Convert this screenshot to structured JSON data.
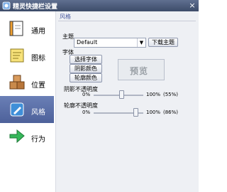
{
  "window": {
    "title": "精灵快捷栏设置",
    "close_glyph": "×"
  },
  "sidebar": {
    "items": [
      {
        "label": "通用",
        "icon": "notebook-icon"
      },
      {
        "label": "图标",
        "icon": "sticky-note-icon"
      },
      {
        "label": "位置",
        "icon": "boxes-icon"
      },
      {
        "label": "风格",
        "icon": "pen-icon",
        "active": true
      },
      {
        "label": "行为",
        "icon": "arrow-icon"
      }
    ]
  },
  "content": {
    "section_title": "风格",
    "theme_label": "主题",
    "theme_value": "Default",
    "download_theme_label": "下载主题",
    "font_label": "字体",
    "select_font_label": "选择字体",
    "shadow_color_label": "阴影颜色",
    "outline_color_label": "轮廓颜色",
    "preview_text": "预览",
    "shadow_opacity_label": "阴影不透明度",
    "shadow_min": "0%",
    "shadow_max": "100%",
    "shadow_value": "(55%)",
    "shadow_level": 0.55,
    "outline_opacity_label": "轮廓不透明度",
    "outline_min": "0%",
    "outline_max": "100%",
    "outline_value": "(86%)",
    "outline_level": 0.86
  },
  "colors": {
    "accent": "#4d619a",
    "title_bar": "#3d4c69"
  }
}
